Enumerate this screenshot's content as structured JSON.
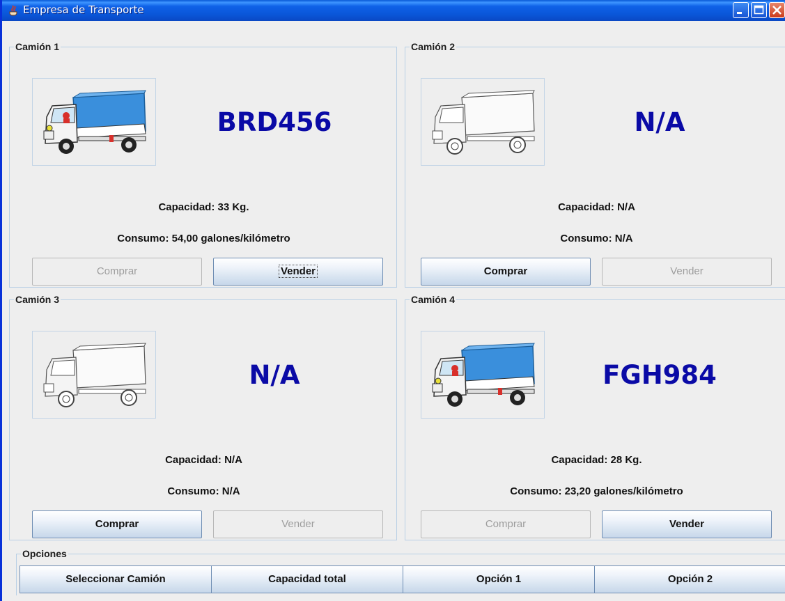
{
  "window": {
    "title": "Empresa de Transporte"
  },
  "trucks": [
    {
      "label": "Camión 1",
      "plate": "BRD456",
      "capacity": "Capacidad:  33 Kg.",
      "consumption": "Consumo:  54,00 galones/kilómetro",
      "buy": "Comprar",
      "sell": "Vender",
      "buy_enabled": false,
      "sell_enabled": true,
      "image": "truck-colored"
    },
    {
      "label": "Camión 2",
      "plate": "N/A",
      "capacity": "Capacidad: N/A",
      "consumption": "Consumo: N/A",
      "buy": "Comprar",
      "sell": "Vender",
      "buy_enabled": true,
      "sell_enabled": false,
      "image": "truck-outline"
    },
    {
      "label": "Camión 3",
      "plate": "N/A",
      "capacity": "Capacidad: N/A",
      "consumption": "Consumo: N/A",
      "buy": "Comprar",
      "sell": "Vender",
      "buy_enabled": true,
      "sell_enabled": false,
      "image": "truck-outline"
    },
    {
      "label": "Camión 4",
      "plate": "FGH984",
      "capacity": "Capacidad:  28 Kg.",
      "consumption": "Consumo:  23,20 galones/kilómetro",
      "buy": "Comprar",
      "sell": "Vender",
      "buy_enabled": false,
      "sell_enabled": true,
      "image": "truck-colored"
    }
  ],
  "options": {
    "label": "Opciones",
    "buttons": [
      "Seleccionar Camión",
      "Capacidad total",
      "Opción 1",
      "Opción 2"
    ]
  },
  "colors": {
    "plate": "#0a0aa6",
    "truck_box": "#3a8fdc",
    "titlebar": "#0a56d8"
  }
}
